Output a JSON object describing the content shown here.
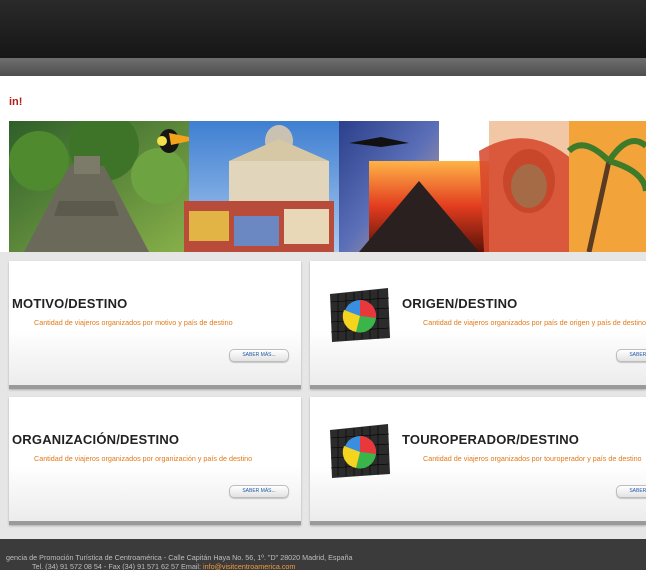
{
  "header": {
    "headline": "in!"
  },
  "cards": [
    {
      "title": "MOTIVO/DESTINO",
      "description": "Cantidad de viajeros organizados por motivo y país de destino",
      "button_label": "SABER MÁS..."
    },
    {
      "title": "ORIGEN/DESTINO",
      "description": "Cantidad de viajeros organizados por país de origen y país de destino",
      "button_label": "SABER MÁS..."
    },
    {
      "title": "ORGANIZACIÓN/DESTINO",
      "description": "Cantidad de viajeros organizados por organización y país de destino",
      "button_label": "SABER MÁS..."
    },
    {
      "title": "TOUROPERADOR/DESTINO",
      "description": "Cantidad de viajeros organizados por touroperador y país de destino",
      "button_label": "SABER MÁS..."
    }
  ],
  "footer": {
    "line1": "gencia de Promoción Turística de Centroamérica - Calle Capitán Haya No. 56, 1º. \"D\" 28020 Madrid, España",
    "line2": "Tel. (34) 91 572 08 54 - Fax (34) 91 571 62 57 Email:",
    "email": "info@visitcentroamerica.com"
  },
  "colors": {
    "accent_orange": "#e07a1a",
    "headline_red": "#b0201a",
    "footer_bg": "#3b3b3b",
    "link_blue": "#1f5aa8"
  },
  "icons": [
    "pie-chart-icon"
  ]
}
